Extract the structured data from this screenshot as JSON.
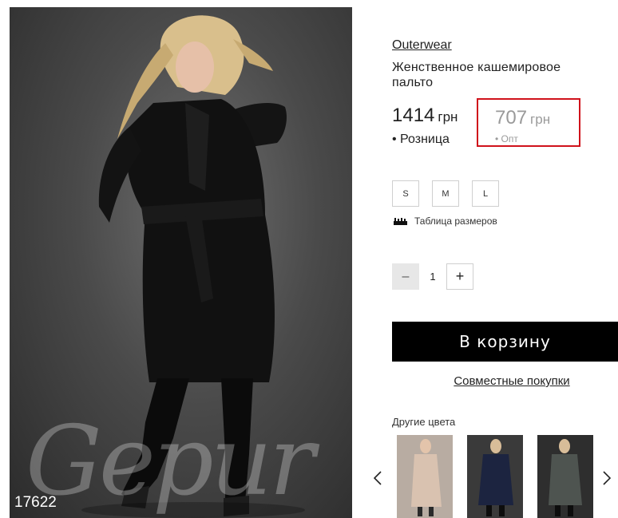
{
  "product": {
    "sku": "17622",
    "watermark": "Gepur",
    "category": "Outerwear",
    "title": "Женственное кашемировое пальто"
  },
  "prices": {
    "retail": {
      "value": "1414",
      "currency": "грн",
      "label": "• Розница"
    },
    "wholesale": {
      "value": "707",
      "currency": "грн",
      "label": "• Опт"
    },
    "highlight_color": "#d0121b"
  },
  "sizes": {
    "options": [
      "S",
      "M",
      "L"
    ],
    "chart_label": "Таблица размеров",
    "chart_icon": "ruler-icon"
  },
  "quantity": {
    "value": "1",
    "minus": "–",
    "plus": "+"
  },
  "actions": {
    "add_to_cart": "В корзину",
    "joint_purchase": "Совместные покупки"
  },
  "other_colors": {
    "title": "Другие цвета",
    "thumbnails": [
      {
        "name": "beige-coat-thumb",
        "color": "#d9c2b0"
      },
      {
        "name": "navy-coat-thumb",
        "color": "#1c2440"
      },
      {
        "name": "gray-coat-thumb",
        "color": "#4e5450"
      }
    ],
    "prev_icon": "chevron-left-icon",
    "next_icon": "chevron-right-icon"
  }
}
